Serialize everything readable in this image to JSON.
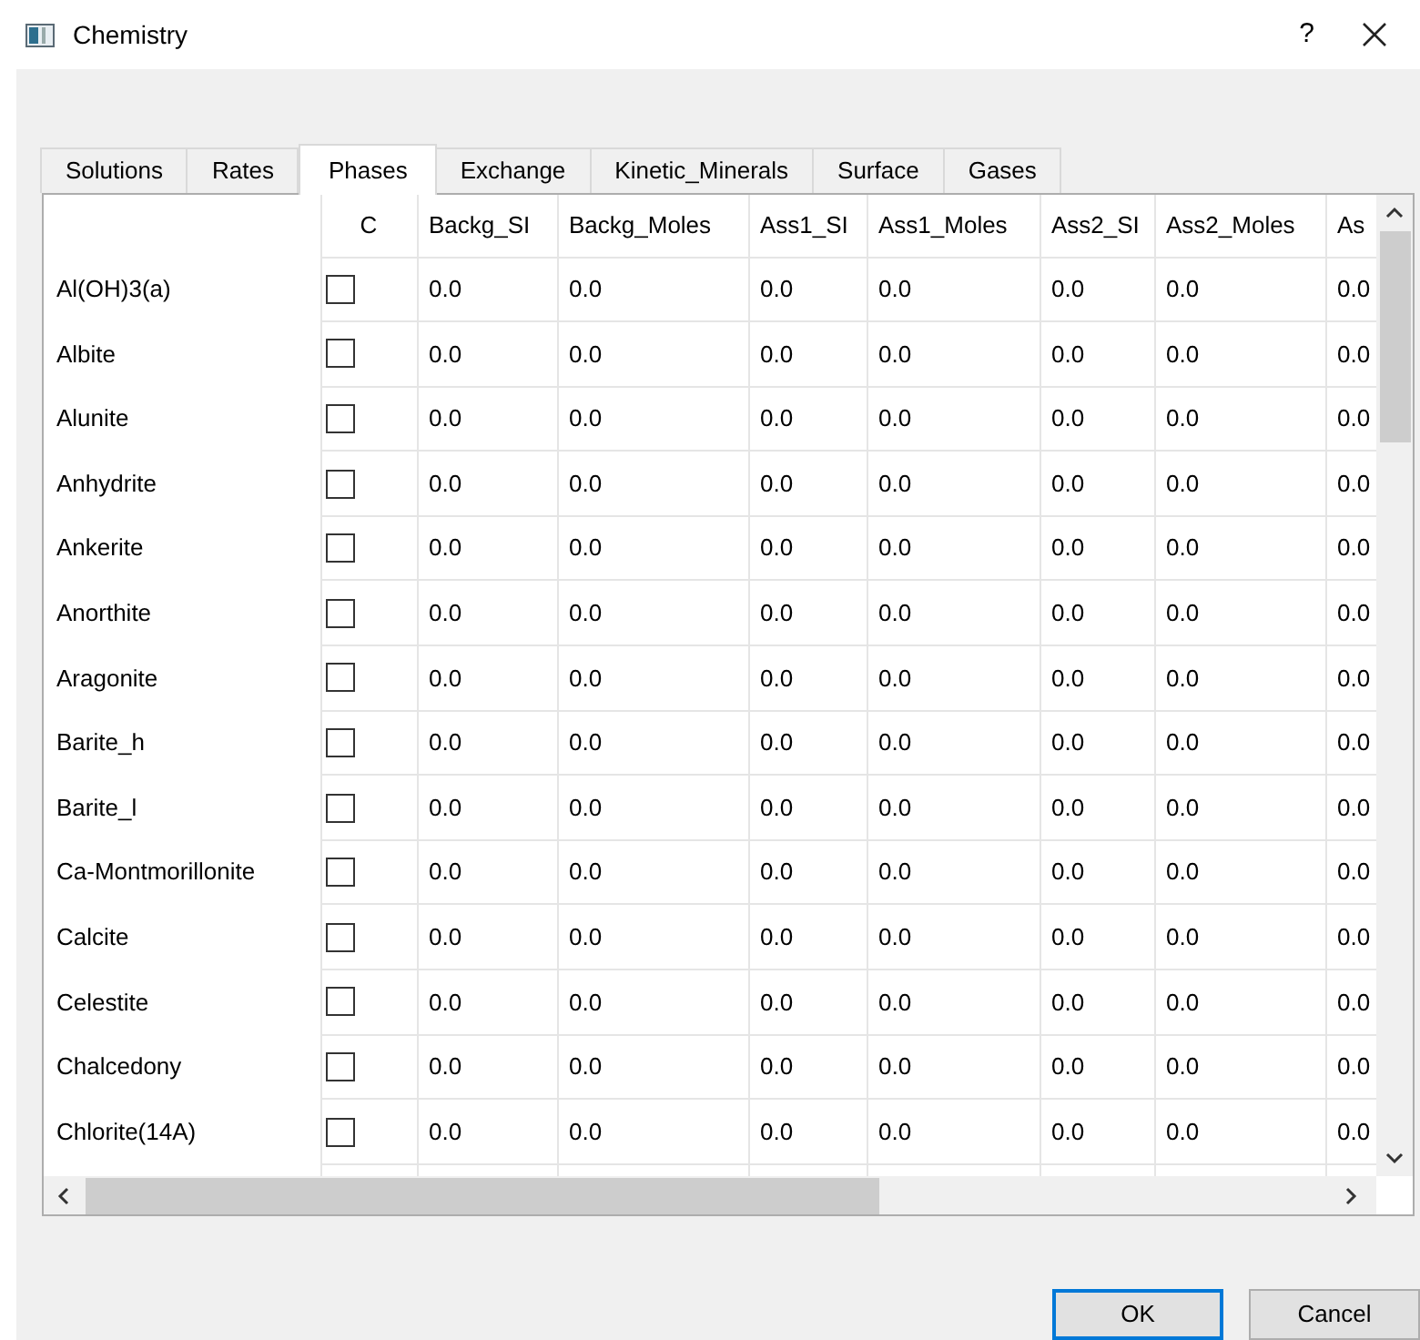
{
  "window": {
    "title": "Chemistry",
    "help": "?"
  },
  "tabs": [
    {
      "label": "Solutions",
      "selected": false
    },
    {
      "label": "Rates",
      "selected": false
    },
    {
      "label": "Phases",
      "selected": true
    },
    {
      "label": "Exchange",
      "selected": false
    },
    {
      "label": "Kinetic_Minerals",
      "selected": false
    },
    {
      "label": "Surface",
      "selected": false
    },
    {
      "label": "Gases",
      "selected": false
    }
  ],
  "table": {
    "columns": [
      "C",
      "Backg_SI",
      "Backg_Moles",
      "Ass1_SI",
      "Ass1_Moles",
      "Ass2_SI",
      "Ass2_Moles",
      "As"
    ],
    "rows": [
      {
        "name": "Al(OH)3(a)",
        "checked": false,
        "values": [
          "0.0",
          "0.0",
          "0.0",
          "0.0",
          "0.0",
          "0.0",
          "0.0"
        ]
      },
      {
        "name": "Albite",
        "checked": false,
        "values": [
          "0.0",
          "0.0",
          "0.0",
          "0.0",
          "0.0",
          "0.0",
          "0.0"
        ]
      },
      {
        "name": "Alunite",
        "checked": false,
        "values": [
          "0.0",
          "0.0",
          "0.0",
          "0.0",
          "0.0",
          "0.0",
          "0.0"
        ]
      },
      {
        "name": "Anhydrite",
        "checked": false,
        "values": [
          "0.0",
          "0.0",
          "0.0",
          "0.0",
          "0.0",
          "0.0",
          "0.0"
        ]
      },
      {
        "name": "Ankerite",
        "checked": false,
        "values": [
          "0.0",
          "0.0",
          "0.0",
          "0.0",
          "0.0",
          "0.0",
          "0.0"
        ]
      },
      {
        "name": "Anorthite",
        "checked": false,
        "values": [
          "0.0",
          "0.0",
          "0.0",
          "0.0",
          "0.0",
          "0.0",
          "0.0"
        ]
      },
      {
        "name": "Aragonite",
        "checked": false,
        "values": [
          "0.0",
          "0.0",
          "0.0",
          "0.0",
          "0.0",
          "0.0",
          "0.0"
        ]
      },
      {
        "name": "Barite_h",
        "checked": false,
        "values": [
          "0.0",
          "0.0",
          "0.0",
          "0.0",
          "0.0",
          "0.0",
          "0.0"
        ]
      },
      {
        "name": "Barite_l",
        "checked": false,
        "values": [
          "0.0",
          "0.0",
          "0.0",
          "0.0",
          "0.0",
          "0.0",
          "0.0"
        ]
      },
      {
        "name": "Ca-Montmorillonite",
        "checked": false,
        "values": [
          "0.0",
          "0.0",
          "0.0",
          "0.0",
          "0.0",
          "0.0",
          "0.0"
        ]
      },
      {
        "name": "Calcite",
        "checked": false,
        "values": [
          "0.0",
          "0.0",
          "0.0",
          "0.0",
          "0.0",
          "0.0",
          "0.0"
        ]
      },
      {
        "name": "Celestite",
        "checked": false,
        "values": [
          "0.0",
          "0.0",
          "0.0",
          "0.0",
          "0.0",
          "0.0",
          "0.0"
        ]
      },
      {
        "name": "Chalcedony",
        "checked": false,
        "values": [
          "0.0",
          "0.0",
          "0.0",
          "0.0",
          "0.0",
          "0.0",
          "0.0"
        ]
      },
      {
        "name": "Chlorite(14A)",
        "checked": false,
        "values": [
          "0.0",
          "0.0",
          "0.0",
          "0.0",
          "0.0",
          "0.0",
          "0.0"
        ]
      }
    ]
  },
  "buttons": [
    {
      "label": "OK",
      "default": true
    },
    {
      "label": "Cancel",
      "default": false
    }
  ]
}
